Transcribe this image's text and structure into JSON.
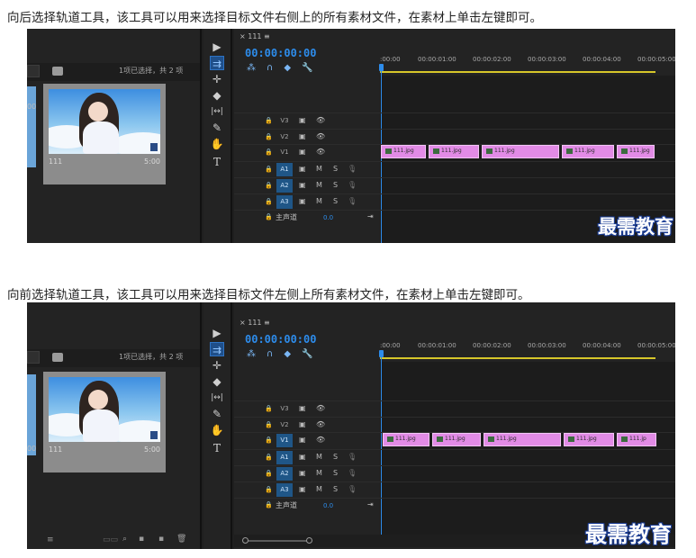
{
  "captions": [
    "向后选择轨道工具，该工具可以用来选择目标文件右侧上的所有素材文件，在素材上单击左键即可。",
    "向前选择轨道工具，该工具可以用来选择目标文件左侧上所有素材文件，在素材上单击左键即可。"
  ],
  "watermark": "最需教育",
  "project": {
    "selection_text": "1项已选择，共 2 项",
    "clip_name": "111",
    "clip_duration": "5:00",
    "left_partial": "00"
  },
  "timeline": {
    "sequence_tab": "× 111 ≡",
    "timecode": "00:00:00:00",
    "ruler": [
      ":00:00",
      "00:00:01:00",
      "00:00:02:00",
      "00:00:03:00",
      "00:00:04:00",
      "00:00:05:00"
    ],
    "video_tracks": [
      "V3",
      "V2",
      "V1"
    ],
    "audio_tracks": [
      "A1",
      "A2",
      "A3"
    ],
    "master": "主声道",
    "master_volume": "0.0",
    "clips_a": [
      "111.jpg",
      "111.jpg",
      "111.jpg",
      "111.jpg",
      "111.jpg"
    ],
    "clips_b": [
      "111.jpg",
      "111.jpg",
      "111.jpg",
      "111.jpg",
      "111.jp"
    ]
  },
  "track_labels": {
    "m": "M",
    "s": "S"
  },
  "icons": {
    "selection_tool": "▶",
    "track_select_tool": "⇉",
    "ripple_tool": "✛",
    "razor_tool": "◆",
    "slip_tool": "|↔|",
    "pen_tool": "✎",
    "hand_tool": "✋",
    "type_tool": "T",
    "lock": "🔒",
    "eye": "👁",
    "film": "▣",
    "mic": "🎙",
    "snap": "⁂",
    "link": "∩",
    "marker": "◆",
    "wrench": "🔧",
    "list_icon": "≡",
    "search_icon": "⌕",
    "bin_icon": "▪",
    "trash_icon": "🗑"
  }
}
